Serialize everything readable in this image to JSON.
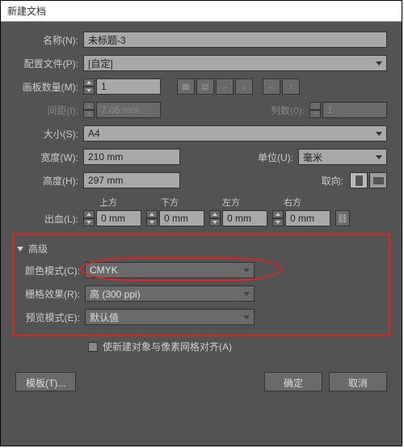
{
  "title": "新建文档",
  "labels": {
    "name": "名称(N):",
    "profile": "配置文件(P):",
    "artboards": "画板数量(M):",
    "spacing": "间距(I):",
    "columns": "列数(0):",
    "size": "大小(S):",
    "width": "宽度(W):",
    "units": "单位(U):",
    "height": "高度(H):",
    "orientation": "取向:",
    "bleed": "出血(L):",
    "top": "上方",
    "bottom": "下方",
    "left": "左方",
    "right": "右方",
    "advanced": "高级",
    "colormode": "颜色模式(C):",
    "raster": "栅格效果(R):",
    "preview": "预览模式(E):",
    "align": "使新建对象与像素网格对齐(A)"
  },
  "values": {
    "name": "未标题-3",
    "profile": "[自定]",
    "artboards": "1",
    "spacing": "7.06 mm",
    "columns": "1",
    "size": "A4",
    "width": "210 mm",
    "units": "毫米",
    "height": "297 mm",
    "bleed_top": "0 mm",
    "bleed_bottom": "0 mm",
    "bleed_left": "0 mm",
    "bleed_right": "0 mm",
    "colormode": "CMYK",
    "raster": "高 (300 ppi)",
    "preview": "默认值"
  },
  "buttons": {
    "template": "模板(T)...",
    "ok": "确定",
    "cancel": "取消"
  }
}
